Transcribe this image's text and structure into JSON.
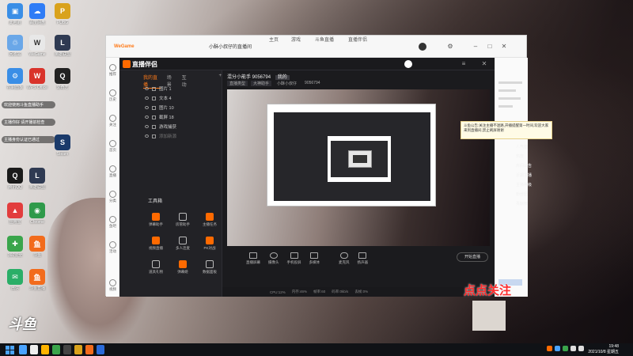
{
  "desktop": {
    "icons": [
      {
        "label": "此电脑",
        "color": "#3a8ee6",
        "glyph": "▣"
      },
      {
        "label": "百度网盘",
        "color": "#2f7cf6",
        "glyph": "☁"
      },
      {
        "label": "PUBG",
        "color": "#d9a21c",
        "glyph": "P"
      },
      {
        "label": "回收站",
        "color": "#6aa7e8",
        "glyph": "♲"
      },
      {
        "label": "WeGame",
        "color": "#e8e8e8",
        "glyph": "W"
      },
      {
        "label": "英雄联盟",
        "color": "#2f3a52",
        "glyph": "L"
      },
      {
        "label": "控制面板",
        "color": "#3a8ee6",
        "glyph": "⚙"
      },
      {
        "label": "WPS Office",
        "color": "#d9332b",
        "glyph": "W"
      },
      {
        "label": "爱奇艺",
        "color": "#222",
        "glyph": "Q"
      },
      {
        "label": "腾讯QQ",
        "color": "#1a1a1a",
        "glyph": "Q"
      },
      {
        "label": "英雄联盟",
        "color": "#2f3a52",
        "glyph": "L"
      },
      {
        "label": "Steam",
        "color": "#1a3a6a",
        "glyph": "S"
      },
      {
        "label": "应用宝",
        "color": "#e23d3d",
        "glyph": "▲"
      },
      {
        "label": "Chrome",
        "color": "#2f9a4a",
        "glyph": "◉"
      },
      {
        "label": "微信",
        "color": "#2aae67",
        "glyph": "✉"
      },
      {
        "label": "斗鱼",
        "color": "#f26b1c",
        "glyph": "鱼"
      },
      {
        "label": "360安全",
        "color": "#3aa54b",
        "glyph": "✚"
      },
      {
        "label": "斗鱼直播",
        "color": "#f26b1c",
        "glyph": "鱼"
      }
    ],
    "notes": [
      "欢迎使用斗鱼直播助手",
      "主播你好 请开播前检查",
      "主播身份认证已通过"
    ],
    "fish_logo": "斗鱼"
  },
  "window": {
    "title": "小酥小叔仔的直播间",
    "tabs": [
      "WeGame",
      "主页",
      "游戏",
      "斗鱼直播",
      "直播伴侣"
    ],
    "left_sidebar": [
      "推荐",
      "历史",
      "关注",
      "首页",
      "直播",
      "分类",
      "鱼吧",
      "活动",
      "视频"
    ]
  },
  "companion": {
    "app_name": "直播伴侣",
    "scene_tabs": [
      "我的直播",
      "场景",
      "互动"
    ],
    "active_tab": 0,
    "scenes": [
      "图片 1",
      "文本 4",
      "图片 10",
      "截屏 18",
      "游戏捕获",
      "添加新源"
    ],
    "tools_title": "工具箱",
    "tools": [
      "弹幕助手",
      "房管助手",
      "主播任务",
      "视频直播",
      "多人连麦",
      "PK对战",
      "道具礼物",
      "弹幕姬",
      "数据面板"
    ],
    "room_title": "混分小能手 9056794",
    "room_tag": "我的",
    "room_meta": [
      "直播类型",
      "大神助手",
      "小酥小叔仔",
      "9056794"
    ],
    "controls": [
      "直播屏幕",
      "摄像头",
      "手机投屏",
      "多媒体",
      "麦克风",
      "扬声器"
    ],
    "start_label": "开始直播",
    "status": [
      "CPU:12%",
      "内存:46%",
      "帧率:60",
      "码率:0kb/s",
      "丢帧:0%"
    ]
  },
  "overlay": {
    "notice": "斗鱼公告:关注主播不迷路,开播提醒第一时间,欢迎大家来到直播间,禁止刷屏谢谢",
    "side_texts": [
      "人气值",
      "热度",
      "房间公告",
      "近期主播",
      "主播等级",
      "粉丝团",
      "贡献榜"
    ],
    "follow_big": "点点关注",
    "follow_small": "点点关注"
  },
  "taskbar": {
    "time": "19:48",
    "date": "2021/10/8 星期五",
    "apps": [
      "#4aa3ff",
      "#ffffff",
      "#ffb400",
      "#3aa54b",
      "#444",
      "#d9a21c",
      "#f26b1c",
      "#2a6ad9"
    ]
  },
  "colors": {
    "accent": "#ff7a18",
    "follow_red": "#ff2b2b"
  }
}
